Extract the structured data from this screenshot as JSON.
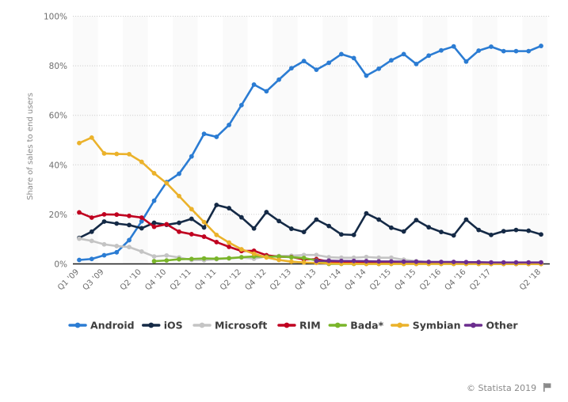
{
  "chart_data": {
    "type": "line",
    "title": "",
    "subtitle": "",
    "xlabel": "",
    "ylabel": "Share of sales to end users",
    "ylim": [
      0,
      100
    ],
    "ytick_labels": [
      "0%",
      "20%",
      "40%",
      "60%",
      "80%",
      "100%"
    ],
    "ytick_values": [
      0,
      20,
      40,
      60,
      80,
      100
    ],
    "grid": true,
    "legend_position": "bottom",
    "value_unit": "%",
    "x": [
      "Q1 '09",
      "Q2 '09",
      "Q3 '09",
      "Q4 '09",
      "Q1 '10",
      "Q2 '10",
      "Q3 '10",
      "Q4 '10",
      "Q1 '11",
      "Q2 '11",
      "Q3 '11",
      "Q4 '11",
      "Q1 '12",
      "Q2 '12",
      "Q3 '12",
      "Q4 '12",
      "Q1 '13",
      "Q2 '13",
      "Q3 '13",
      "Q4 '13",
      "Q1 '14",
      "Q2 '14",
      "Q3 '14",
      "Q4 '14",
      "Q1 '15",
      "Q2 '15",
      "Q3 '15",
      "Q4 '15",
      "Q1 '16",
      "Q2 '16",
      "Q3 '16",
      "Q4 '16",
      "Q1 '17",
      "Q2 '17",
      "Q3 '17",
      "Q4 '17",
      "Q1 '18",
      "Q2 '18"
    ],
    "xtick_labels": [
      "Q1 '09",
      "Q3 '09",
      "Q2 '10",
      "Q4 '10",
      "Q2 '11",
      "Q4 '11",
      "Q2 '12",
      "Q4 '12",
      "Q2 '13",
      "Q4 '13",
      "Q2 '14",
      "Q4 '14",
      "Q2 '15",
      "Q4 '15",
      "Q2 '16",
      "Q4 '16",
      "Q2 '17",
      "Q2 '18"
    ],
    "xtick_indices": [
      0,
      2,
      5,
      7,
      9,
      11,
      13,
      15,
      17,
      19,
      21,
      23,
      25,
      27,
      29,
      31,
      33,
      37
    ],
    "series": [
      {
        "name": "Android",
        "color": "#2b7cd3",
        "values": [
          1.6,
          2.0,
          3.5,
          4.7,
          9.6,
          17.2,
          25.5,
          33.0,
          36.4,
          43.4,
          52.5,
          51.3,
          56.1,
          64.1,
          72.4,
          69.7,
          74.4,
          79.0,
          81.9,
          78.4,
          81.2,
          84.7,
          83.1,
          76.0,
          78.8,
          82.2,
          84.7,
          80.7,
          84.1,
          86.2,
          87.8,
          81.7,
          86.1,
          87.7,
          85.9,
          85.9,
          85.9,
          88.0
        ]
      },
      {
        "name": "iOS",
        "color": "#152a46",
        "values": [
          10.5,
          13.0,
          17.1,
          16.3,
          15.7,
          14.4,
          16.6,
          15.8,
          16.6,
          18.2,
          14.7,
          23.8,
          22.5,
          18.8,
          14.3,
          20.9,
          17.3,
          14.2,
          12.9,
          17.9,
          15.3,
          11.9,
          11.7,
          20.4,
          17.9,
          14.6,
          13.1,
          17.7,
          14.8,
          12.9,
          11.5,
          17.9,
          13.7,
          11.7,
          13.2,
          13.7,
          13.4,
          11.9
        ]
      },
      {
        "name": "Microsoft",
        "color": "#c4c4c4",
        "values": [
          10.2,
          9.3,
          7.9,
          7.2,
          6.8,
          5.0,
          3.0,
          3.4,
          2.6,
          1.6,
          1.5,
          1.9,
          2.2,
          2.6,
          2.1,
          3.0,
          3.2,
          3.3,
          3.6,
          3.6,
          2.7,
          2.5,
          2.5,
          2.8,
          2.5,
          2.5,
          1.7,
          1.1,
          0.8,
          0.6,
          0.4,
          0.4,
          0.3,
          0.3,
          0.2,
          0.2,
          0.2,
          0.2
        ]
      },
      {
        "name": "RIM",
        "color": "#c00020",
        "values": [
          20.8,
          18.7,
          20.0,
          19.9,
          19.4,
          18.7,
          15.0,
          16.0,
          13.0,
          12.0,
          11.0,
          8.8,
          6.9,
          5.2,
          5.3,
          3.5,
          2.9,
          2.8,
          1.8,
          1.9,
          0.9,
          0.6,
          0.5,
          0.4,
          0.3,
          0.3,
          0.2,
          0.2,
          0.2,
          0.1,
          0.1,
          0.1,
          0.1,
          0.0,
          0.0,
          0.0,
          0.0,
          0.0
        ]
      },
      {
        "name": "Bada*",
        "color": "#7ab52a",
        "values": [
          null,
          null,
          null,
          null,
          null,
          null,
          1.1,
          1.4,
          1.9,
          2.0,
          2.2,
          2.1,
          2.3,
          2.7,
          3.0,
          2.9,
          3.0,
          2.7,
          2.4,
          1.4,
          0.0,
          0.0,
          0.0,
          0.0,
          0.0,
          0.0,
          0.0,
          0.0,
          0.0,
          0.0,
          0.0,
          0.0,
          0.0,
          0.0,
          0.0,
          0.0,
          0.0,
          0.0
        ]
      },
      {
        "name": "Symbian",
        "color": "#ebb22b",
        "values": [
          48.8,
          51.0,
          44.6,
          44.4,
          44.3,
          41.2,
          36.6,
          32.6,
          27.4,
          22.1,
          16.9,
          11.7,
          8.6,
          5.9,
          4.1,
          2.6,
          1.6,
          0.9,
          0.6,
          0.4,
          0.2,
          0.1,
          0.1,
          0.0,
          0.0,
          0.0,
          0.0,
          0.0,
          0.0,
          0.0,
          0.0,
          0.0,
          0.0,
          0.0,
          0.0,
          0.0,
          0.0,
          0.0
        ]
      },
      {
        "name": "Other",
        "color": "#6b2d8e",
        "values": [
          null,
          null,
          null,
          null,
          null,
          null,
          null,
          null,
          null,
          null,
          null,
          null,
          null,
          null,
          null,
          null,
          null,
          null,
          null,
          1.2,
          1.3,
          1.2,
          1.2,
          1.1,
          1.0,
          1.0,
          0.9,
          0.9,
          0.8,
          0.8,
          0.8,
          0.7,
          0.7,
          0.6,
          0.6,
          0.6,
          0.6,
          0.6
        ]
      }
    ]
  },
  "legend": {
    "items": [
      {
        "label": "Android",
        "color": "#2b7cd3"
      },
      {
        "label": "iOS",
        "color": "#152a46"
      },
      {
        "label": "Microsoft",
        "color": "#c4c4c4"
      },
      {
        "label": "RIM",
        "color": "#c00020"
      },
      {
        "label": "Bada*",
        "color": "#7ab52a"
      },
      {
        "label": "Symbian",
        "color": "#ebb22b"
      },
      {
        "label": "Other",
        "color": "#6b2d8e"
      }
    ]
  },
  "footer": {
    "copyright": "© Statista 2019",
    "flag_icon": "flag-icon"
  }
}
